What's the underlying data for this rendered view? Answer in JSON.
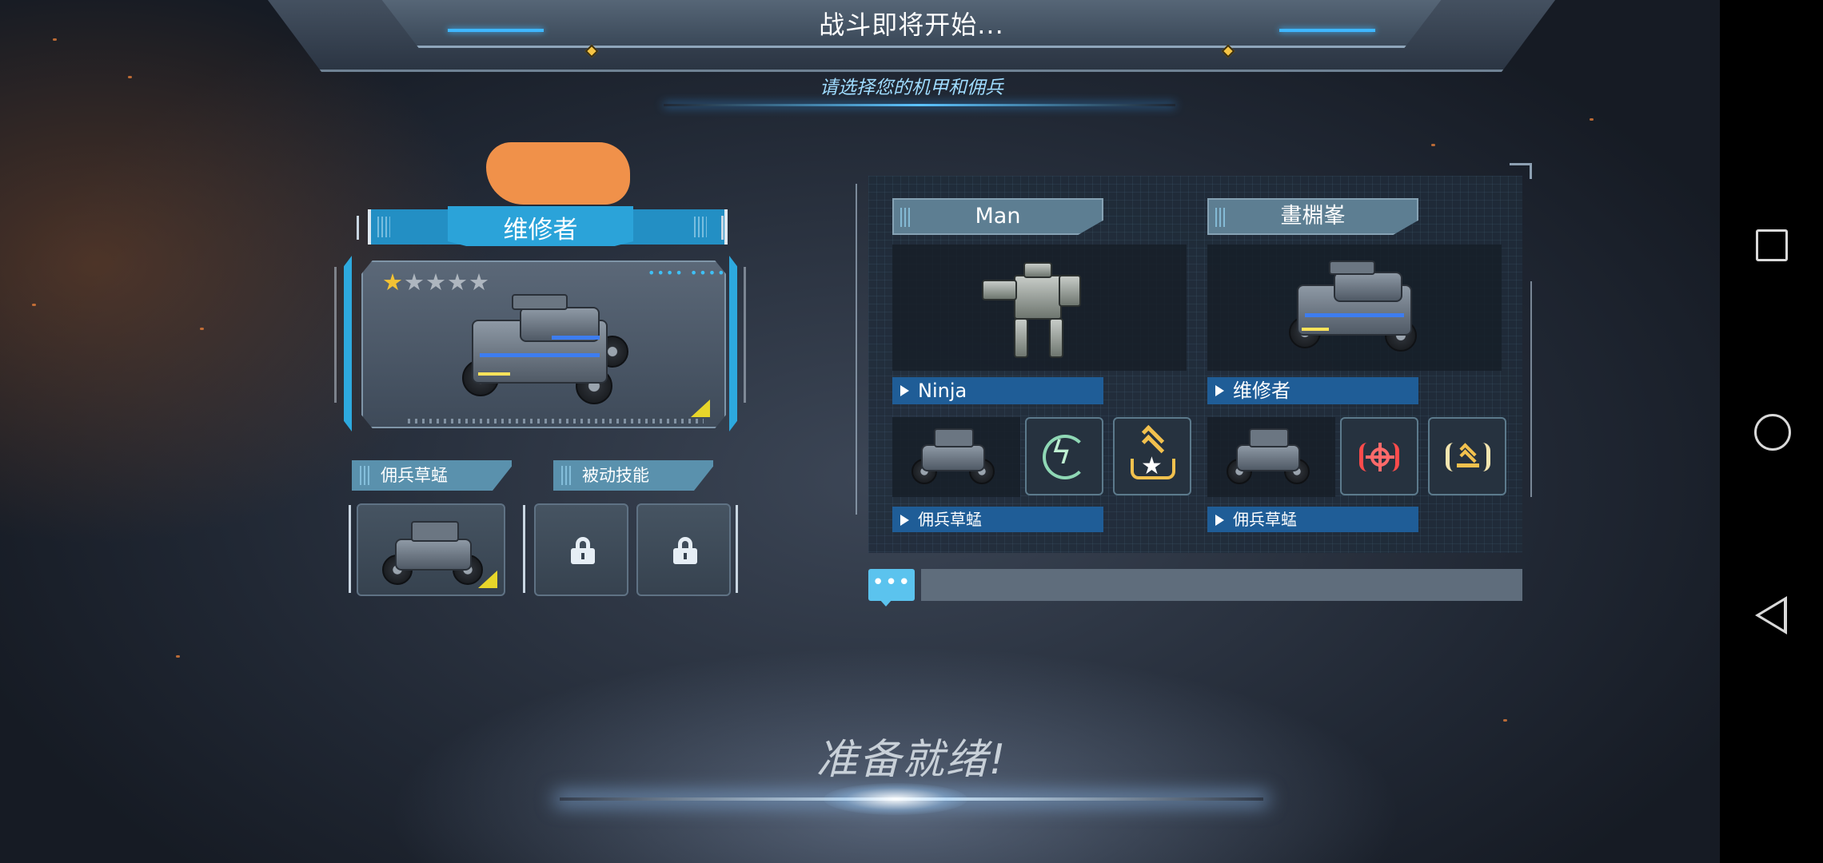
{
  "header": {
    "title": "战斗即将开始...",
    "subtitle": "请选择您的机甲和佣兵"
  },
  "player": {
    "mech_name": "维修者",
    "stars_filled": 1,
    "stars_total": 5,
    "mercenary_label": "佣兵草蜢",
    "passive_label": "被动技能"
  },
  "team": [
    {
      "player_name": "Man",
      "mech_name": "Ninja",
      "mercenary_name": "佣兵草蜢",
      "skills": [
        "energy-recharge-icon",
        "rank-star-icon"
      ]
    },
    {
      "player_name": "畫棩峯",
      "mech_name": "维修者",
      "mercenary_name": "佣兵草蜢",
      "skills": [
        "target-lock-icon",
        "speed-boost-icon"
      ]
    }
  ],
  "chat": {
    "button_label": "•••",
    "input_value": ""
  },
  "status": {
    "ready_text": "准备就绪!"
  },
  "colors": {
    "accent_blue": "#2ba3d9",
    "star_gold": "#f3c234",
    "panel_label_blue": "#1f5d97"
  }
}
